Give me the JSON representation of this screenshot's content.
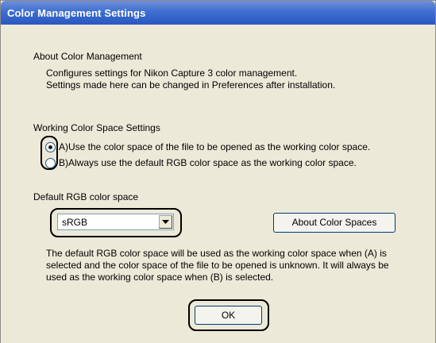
{
  "window": {
    "title": "Color Management Settings"
  },
  "about": {
    "heading": "About Color Management",
    "lines": [
      "Configures settings for Nikon Capture 3 color management.",
      "Settings made here can be changed in Preferences after installation."
    ]
  },
  "working": {
    "heading": "Working Color Space Settings",
    "options": [
      {
        "label": "A)Use the color space of the file to be opened as the working color space.",
        "selected": true
      },
      {
        "label": "B)Always use the default RGB color space as the working color space.",
        "selected": false
      }
    ]
  },
  "default_rgb": {
    "heading": "Default RGB color space",
    "selected_value": "sRGB",
    "about_button": "About Color Spaces",
    "description_lines": [
      "The default RGB color space will be used as the working color space when (A) is",
      "selected and the color space of the file to be opened is unknown. It will always be",
      "used as the working color space when (B) is selected."
    ]
  },
  "ok_button": "OK"
}
